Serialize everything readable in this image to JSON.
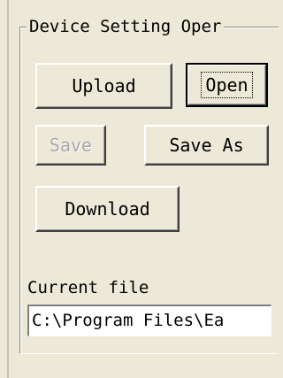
{
  "group": {
    "title": "Device Setting Oper"
  },
  "buttons": {
    "upload": "Upload",
    "open": "Open",
    "save": "Save",
    "save_as": "Save As",
    "download": "Download"
  },
  "current_file": {
    "label": "Current file",
    "value": "C:\\Program Files\\Ea"
  }
}
